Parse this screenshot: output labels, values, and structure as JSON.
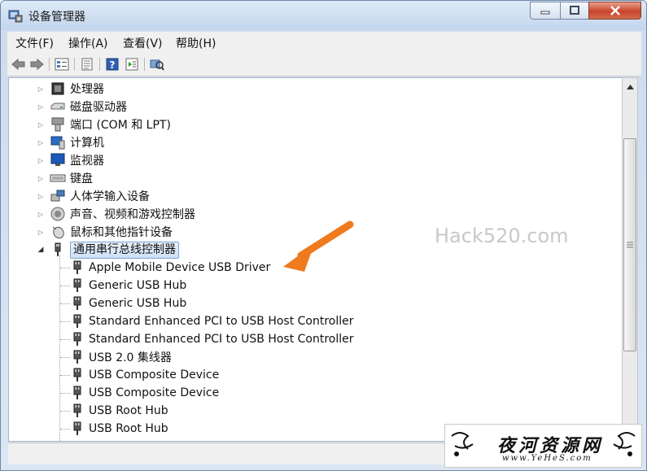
{
  "window": {
    "title": "设备管理器"
  },
  "menu": [
    {
      "label": "文件(F)"
    },
    {
      "label": "操作(A)"
    },
    {
      "label": "查看(V)"
    },
    {
      "label": "帮助(H)"
    }
  ],
  "toolbar_icons": [
    "back-icon",
    "forward-icon",
    "device-view-icon",
    "properties-icon",
    "help-icon",
    "action-icon",
    "scan-hardware-icon"
  ],
  "tree": {
    "categories": [
      {
        "label": "处理器",
        "icon": "processor-icon",
        "expanded": false
      },
      {
        "label": "磁盘驱动器",
        "icon": "disk-drive-icon",
        "expanded": false
      },
      {
        "label": "端口 (COM 和 LPT)",
        "icon": "port-icon",
        "expanded": false
      },
      {
        "label": "计算机",
        "icon": "computer-icon",
        "expanded": false
      },
      {
        "label": "监视器",
        "icon": "monitor-icon",
        "expanded": false
      },
      {
        "label": "键盘",
        "icon": "keyboard-icon",
        "expanded": false
      },
      {
        "label": "人体学输入设备",
        "icon": "hid-icon",
        "expanded": false
      },
      {
        "label": "声音、视频和游戏控制器",
        "icon": "speaker-icon",
        "expanded": false
      },
      {
        "label": "鼠标和其他指针设备",
        "icon": "mouse-icon",
        "expanded": false
      },
      {
        "label": "通用串行总线控制器",
        "icon": "usb-controller-icon",
        "expanded": true,
        "selected": true
      }
    ],
    "usb_children": [
      {
        "label": "Apple Mobile Device USB Driver"
      },
      {
        "label": "Generic USB Hub"
      },
      {
        "label": "Generic USB Hub"
      },
      {
        "label": "Standard Enhanced PCI to USB Host Controller"
      },
      {
        "label": "Standard Enhanced PCI to USB Host Controller"
      },
      {
        "label": "USB 2.0 集线器"
      },
      {
        "label": "USB Composite Device"
      },
      {
        "label": "USB Composite Device"
      },
      {
        "label": "USB Root Hub"
      },
      {
        "label": "USB Root Hub"
      }
    ]
  },
  "watermark": "Hack520.com",
  "stamp": {
    "title": "夜河资源网",
    "url": "www.YeHeS.com"
  },
  "colors": {
    "arrow": "#f07a1e",
    "selection_border": "#7da2ce",
    "close_button": "#c9442a"
  }
}
